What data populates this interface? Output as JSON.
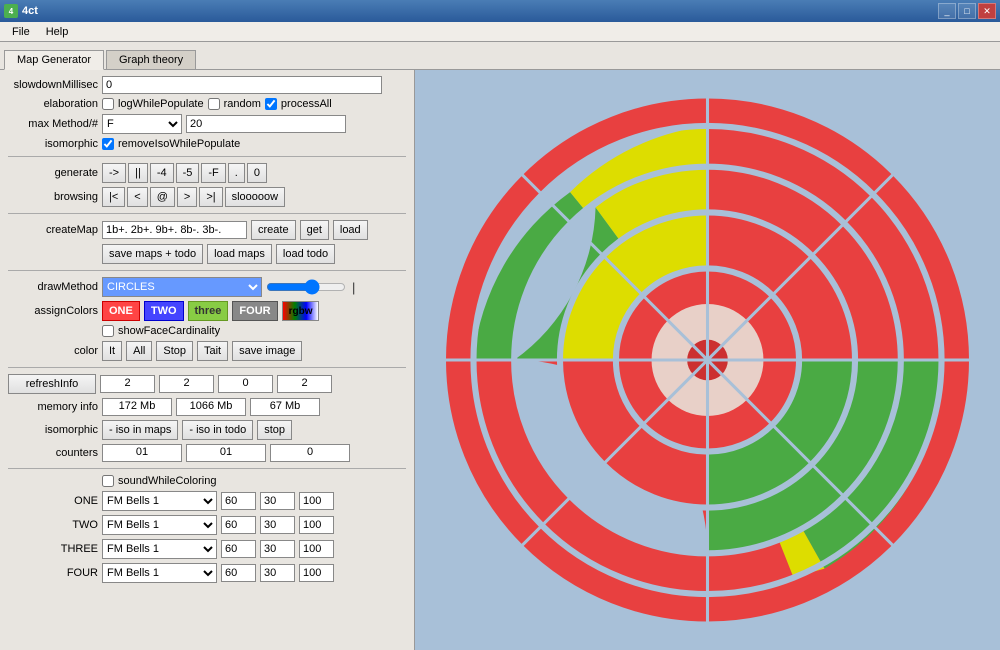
{
  "window": {
    "title": "4ct",
    "icon": "4"
  },
  "menu": {
    "items": [
      "File",
      "Help"
    ]
  },
  "tabs": [
    {
      "label": "Map Generator",
      "active": true
    },
    {
      "label": "Graph theory",
      "active": false
    }
  ],
  "form": {
    "slowdown_label": "slowdownMillisec",
    "slowdown_value": "0",
    "elaboration_label": "elaboration",
    "log_while_populate": "logWhilePopulate",
    "random": "random",
    "process_all": "processAll",
    "max_method_label": "max Method/#",
    "max_method_value": "F",
    "max_method_num": "20",
    "isomorphic_label": "isomorphic",
    "remove_iso": "removeIsoWhilePopulate",
    "generate_label": "generate",
    "generate_btns": [
      "->",
      "||",
      "-4",
      "-5",
      "-F",
      ".",
      "0"
    ],
    "browsing_label": "browsing",
    "browsing_btns": [
      "|<",
      "<",
      "@",
      ">",
      ">|",
      "slooooow"
    ],
    "create_map_label": "createMap",
    "create_map_value": "1b+. 2b+. 9b+. 8b-. 3b-.",
    "create_btn": "create",
    "get_btn": "get",
    "load_btn": "load",
    "save_maps_btn": "save maps + todo",
    "load_maps_btn": "load maps",
    "load_todo_btn": "load todo",
    "draw_method_label": "drawMethod",
    "draw_method_value": "CIRCLES",
    "assign_colors_label": "assignColors",
    "color_btns": [
      "ONE",
      "TWO",
      "three",
      "FOUR",
      "rgbw"
    ],
    "show_face_cardinality": "showFaceCardinality",
    "color_label": "color",
    "color_btns2": [
      "It",
      "All",
      "Stop",
      "Tait",
      "save image"
    ],
    "refresh_label": "refreshInfo",
    "refresh_values": [
      "2",
      "2",
      "0",
      "2"
    ],
    "memory_label": "memory info",
    "memory_values": [
      "172 Mb",
      "1066 Mb",
      "67 Mb"
    ],
    "isomorphic2_label": "isomorphic",
    "iso_btns": [
      "- iso in maps",
      "- iso in todo",
      "stop"
    ],
    "counters_label": "counters",
    "counters_values": [
      "01",
      "01",
      "0"
    ],
    "sound_label": "soundWhileColoring",
    "sounds": [
      {
        "label": "ONE",
        "value": "FM Bells 1",
        "v1": "60",
        "v2": "30",
        "v3": "100"
      },
      {
        "label": "TWO",
        "value": "FM Bells 1",
        "v1": "60",
        "v2": "30",
        "v3": "100"
      },
      {
        "label": "THREE",
        "value": "FM Bells 1",
        "v1": "60",
        "v2": "30",
        "v3": "100"
      },
      {
        "label": "FOUR",
        "value": "FM Bells 1",
        "v1": "60",
        "v2": "30",
        "v3": "100"
      }
    ]
  }
}
